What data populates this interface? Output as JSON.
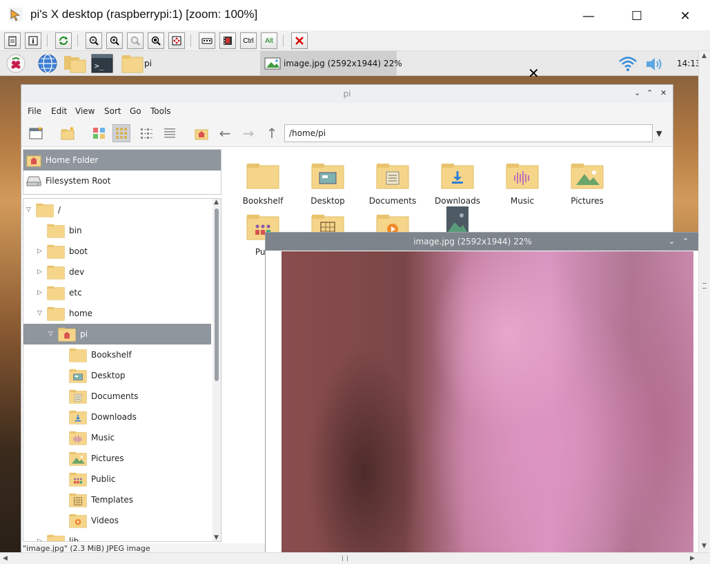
{
  "vnc": {
    "title": "pi's X desktop (raspberrypi:1) [zoom: 100%]",
    "minimize": "—",
    "maximize": "☐",
    "close": "✕",
    "toolbar": {
      "ctrl": "Ctrl",
      "alt": "Alt"
    }
  },
  "taskbar": {
    "pi_label": "pi",
    "image_label": "image.jpg (2592x1944) 22%",
    "clock": "14:13"
  },
  "fm": {
    "title": "pi",
    "menu": [
      "File",
      "Edit",
      "View",
      "Sort",
      "Go",
      "Tools"
    ],
    "path": "/home/pi",
    "places": [
      {
        "label": "Home Folder"
      },
      {
        "label": "Filesystem Root"
      }
    ],
    "tree": [
      {
        "label": "/",
        "depth": 0,
        "arrow": "▽"
      },
      {
        "label": "bin",
        "depth": 1,
        "arrow": ""
      },
      {
        "label": "boot",
        "depth": 1,
        "arrow": "▷"
      },
      {
        "label": "dev",
        "depth": 1,
        "arrow": "▷"
      },
      {
        "label": "etc",
        "depth": 1,
        "arrow": "▷"
      },
      {
        "label": "home",
        "depth": 1,
        "arrow": "▽"
      },
      {
        "label": "pi",
        "depth": 2,
        "arrow": "▽"
      },
      {
        "label": "Bookshelf",
        "depth": 3,
        "arrow": ""
      },
      {
        "label": "Desktop",
        "depth": 3,
        "arrow": ""
      },
      {
        "label": "Documents",
        "depth": 3,
        "arrow": ""
      },
      {
        "label": "Downloads",
        "depth": 3,
        "arrow": ""
      },
      {
        "label": "Music",
        "depth": 3,
        "arrow": ""
      },
      {
        "label": "Pictures",
        "depth": 3,
        "arrow": ""
      },
      {
        "label": "Public",
        "depth": 3,
        "arrow": ""
      },
      {
        "label": "Templates",
        "depth": 3,
        "arrow": ""
      },
      {
        "label": "Videos",
        "depth": 3,
        "arrow": ""
      },
      {
        "label": "lib",
        "depth": 1,
        "arrow": "▷"
      }
    ],
    "grid": [
      {
        "label": "Bookshelf"
      },
      {
        "label": "Desktop"
      },
      {
        "label": "Documents"
      },
      {
        "label": "Downloads"
      },
      {
        "label": "Music"
      },
      {
        "label": "Pictures"
      },
      {
        "label": "Pub"
      },
      {
        "label": ""
      },
      {
        "label": ""
      },
      {
        "label": ""
      }
    ],
    "status": "\"image.jpg\" (2.3 MiB) JPEG image"
  },
  "viewer": {
    "title": "image.jpg (2592x1944) 22%"
  },
  "colors": {
    "folder": "#f5d58a",
    "folder_dark": "#e9c46e",
    "selection": "#8f969d",
    "home_red": "#d9534f"
  }
}
